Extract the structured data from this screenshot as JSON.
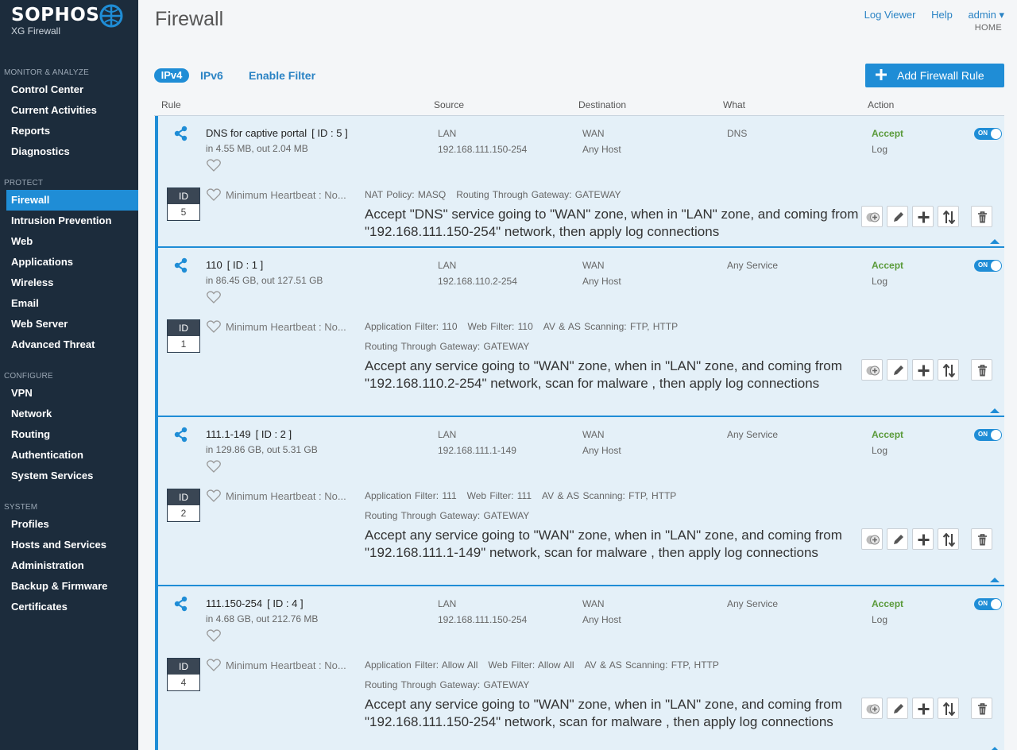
{
  "brand": {
    "name": "SOPHOS",
    "product": "XG Firewall"
  },
  "header": {
    "title": "Firewall",
    "links": [
      "Log Viewer",
      "Help",
      "admin ▾"
    ],
    "crumb": "HOME"
  },
  "toolbar": {
    "tabs": [
      "IPv4",
      "IPv6"
    ],
    "filter_label": "Enable Filter",
    "add_label": "Add Firewall Rule"
  },
  "columns": [
    "Rule",
    "Source",
    "Destination",
    "What",
    "Action"
  ],
  "sidebar": {
    "sections": [
      {
        "heading": "MONITOR & ANALYZE",
        "items": [
          "Control Center",
          "Current Activities",
          "Reports",
          "Diagnostics"
        ]
      },
      {
        "heading": "PROTECT",
        "items": [
          "Firewall",
          "Intrusion Prevention",
          "Web",
          "Applications",
          "Wireless",
          "Email",
          "Web Server",
          "Advanced Threat"
        ]
      },
      {
        "heading": "CONFIGURE",
        "items": [
          "VPN",
          "Network",
          "Routing",
          "Authentication",
          "System Services"
        ]
      },
      {
        "heading": "SYSTEM",
        "items": [
          "Profiles",
          "Hosts and Services",
          "Administration",
          "Backup & Firmware",
          "Certificates"
        ]
      }
    ],
    "active": "Firewall"
  },
  "rules": [
    {
      "name": "DNS for captive portal",
      "id_label": "[ ID : 5 ]",
      "id": "5",
      "traffic": "in 4.55 MB, out 2.04 MB",
      "source_zone": "LAN",
      "source_net": "192.168.111.150-254",
      "dest_zone": "WAN",
      "dest_net": "Any Host",
      "what": "DNS",
      "action": "Accept",
      "log": "Log",
      "toggle": "ON",
      "id_header": "ID",
      "heartbeat": "Minimum Heartbeat : No...",
      "details": [
        [
          "NAT Policy: MASQ",
          "Routing Through Gateway: GATEWAY"
        ]
      ],
      "summary": "Accept \"DNS\" service going to \"WAN\" zone, when in \"LAN\" zone, and coming from \"192.168.111.150-254\" network, then apply log connections"
    },
    {
      "name": "110",
      "id_label": "[ ID : 1 ]",
      "id": "1",
      "traffic": "in 86.45 GB, out 127.51 GB",
      "source_zone": "LAN",
      "source_net": "192.168.110.2-254",
      "dest_zone": "WAN",
      "dest_net": "Any Host",
      "what": "Any Service",
      "action": "Accept",
      "log": "Log",
      "toggle": "ON",
      "id_header": "ID",
      "heartbeat": "Minimum Heartbeat : No...",
      "details": [
        [
          "Application Filter: 110",
          "Web Filter: 110",
          "AV & AS Scanning: FTP, HTTP"
        ],
        [
          "Routing Through Gateway: GATEWAY"
        ]
      ],
      "summary": "Accept any service going to \"WAN\" zone, when in \"LAN\" zone, and coming from \"192.168.110.2-254\" network, scan for malware , then apply log connections"
    },
    {
      "name": "111.1-149",
      "id_label": "[ ID : 2 ]",
      "id": "2",
      "traffic": "in 129.86 GB, out 5.31 GB",
      "source_zone": "LAN",
      "source_net": "192.168.111.1-149",
      "dest_zone": "WAN",
      "dest_net": "Any Host",
      "what": "Any Service",
      "action": "Accept",
      "log": "Log",
      "toggle": "ON",
      "id_header": "ID",
      "heartbeat": "Minimum Heartbeat : No...",
      "details": [
        [
          "Application Filter: 111",
          "Web Filter: 111",
          "AV & AS Scanning: FTP, HTTP"
        ],
        [
          "Routing Through Gateway: GATEWAY"
        ]
      ],
      "summary": "Accept any service going to \"WAN\" zone, when in \"LAN\" zone, and coming from \"192.168.111.1-149\" network, scan for malware , then apply log connections"
    },
    {
      "name": "111.150-254",
      "id_label": "[ ID : 4 ]",
      "id": "4",
      "traffic": "in 4.68 GB, out 212.76 MB",
      "source_zone": "LAN",
      "source_net": "192.168.111.150-254",
      "dest_zone": "WAN",
      "dest_net": "Any Host",
      "what": "Any Service",
      "action": "Accept",
      "log": "Log",
      "toggle": "ON",
      "id_header": "ID",
      "heartbeat": "Minimum Heartbeat : No...",
      "details": [
        [
          "Application Filter: Allow All",
          "Web Filter: Allow All",
          "AV & AS Scanning: FTP, HTTP"
        ],
        [
          "Routing Through Gateway: GATEWAY"
        ]
      ],
      "summary": "Accept any service going to \"WAN\" zone, when in \"LAN\" zone, and coming from \"192.168.111.150-254\" network, scan for malware , then apply log connections"
    }
  ],
  "colors": {
    "sidebar_bg": "#1c2c3c",
    "accent": "#1f8dd6",
    "accept": "#5a9a3a",
    "card_bg": "#e4f0f8"
  },
  "icons": [
    "brand-globe-icon",
    "plus-icon",
    "share-icon",
    "heart-icon",
    "clone-icon",
    "edit-icon",
    "add-icon",
    "move-icon",
    "delete-icon",
    "collapse-caret-icon"
  ]
}
